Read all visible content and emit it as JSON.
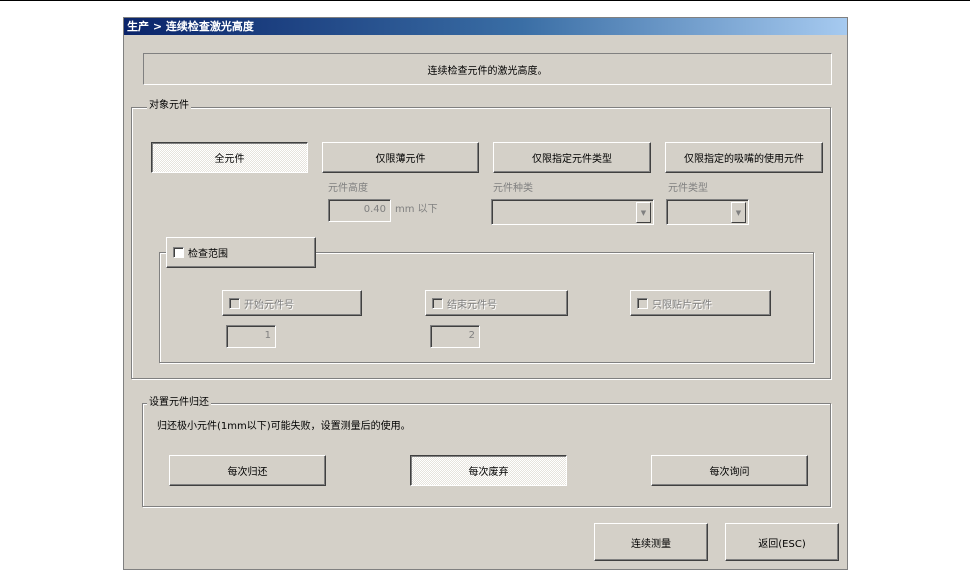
{
  "window": {
    "title": "生产 > 连续检查激光高度"
  },
  "description": "连续检查元件的激光高度。",
  "target_group": {
    "legend": "对象元件",
    "buttons": {
      "all": "全元件",
      "thin": "仅限薄元件",
      "specified_type": "仅限指定元件类型",
      "specified_nozzle": "仅限指定的吸嘴的使用元件"
    },
    "height_label": "元件高度",
    "height_value": "0.40",
    "height_unit": "mm 以下",
    "kind_label": "元件种类",
    "kind_value": "",
    "type_label": "元件类型",
    "type_value": ""
  },
  "range_group": {
    "checkbox_label": "检查范围",
    "start_label": "开始元件号",
    "start_value": "1",
    "end_label": "结束元件号",
    "end_value": "2",
    "smd_label": "只限贴片元件"
  },
  "return_group": {
    "legend": "设置元件归还",
    "note": "归还极小元件(1mm以下)可能失败，设置测量后的使用。",
    "buttons": {
      "return_each": "每次归还",
      "discard_each": "每次废弃",
      "ask_each": "每次询问"
    }
  },
  "footer": {
    "continuous": "连续测量",
    "back": "返回(ESC)"
  }
}
